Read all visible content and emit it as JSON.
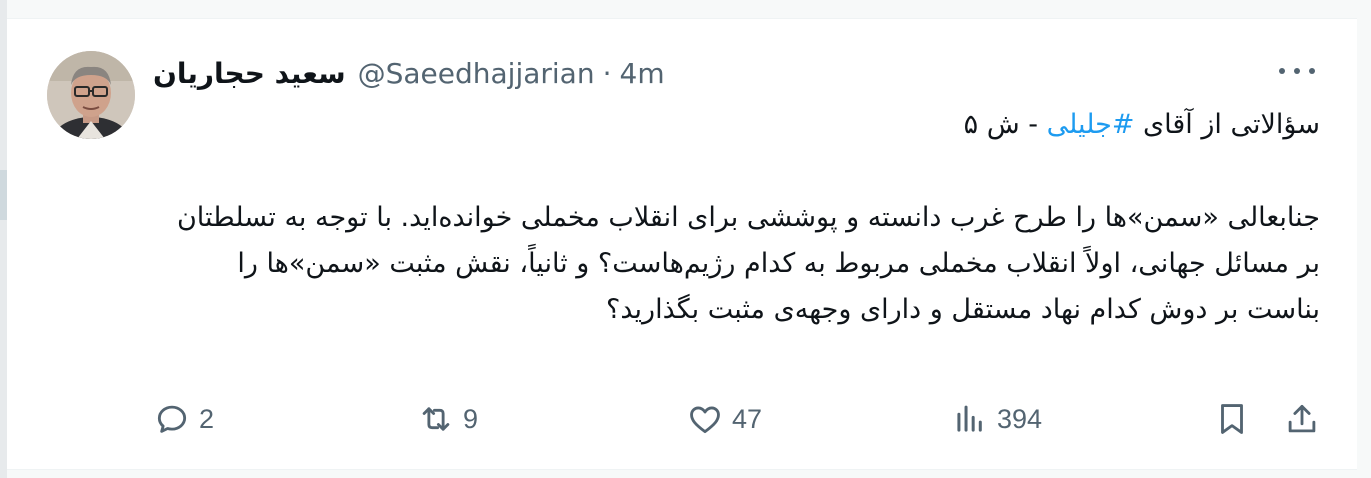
{
  "tweet": {
    "author_name": "سعید حجاریان",
    "handle": "@Saeedhajjarian",
    "separator": "·",
    "time": "4m",
    "line1_prefix": "سؤالاتی از آقای ",
    "hashtag": "#جلیلی",
    "line1_suffix": " - ش ۵",
    "body": "جنابعالی «سمن»ها را طرح غرب دانسته و پوششی برای انقلاب مخملی خوانده‌اید. با توجه به تسلطتان بر مسائل جهانی، اولاً انقلاب مخملی مربوط به کدام رژیم‌هاست؟ و ثانیاً، نقش مثبت «سمن»ها را بناست بر دوش کدام نهاد مستقل و دارای وجهه‌ی مثبت بگذارید؟"
  },
  "actions": {
    "reply_count": "2",
    "retweet_count": "9",
    "like_count": "47",
    "views_count": "394"
  },
  "icons": [
    "reply-icon",
    "retweet-icon",
    "like-icon",
    "views-icon",
    "bookmark-icon",
    "share-icon",
    "more-icon"
  ]
}
